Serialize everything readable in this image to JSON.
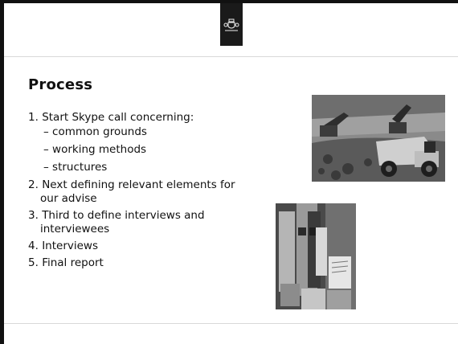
{
  "slide": {
    "title": "Process",
    "items": [
      {
        "num": "1.",
        "text": "Start Skype call concerning:",
        "sub": [
          "common grounds",
          "working methods",
          "structures"
        ]
      },
      {
        "num": "2.",
        "text": "Next defining relevant elements for our advise"
      },
      {
        "num": "3.",
        "text": "Third to define interviews and interviewees"
      },
      {
        "num": "4.",
        "text": "Interviews"
      },
      {
        "num": "5.",
        "text": "Final report"
      }
    ],
    "bullet_char": "–"
  },
  "images": {
    "top_photo": "construction-site-excavator-dump-truck",
    "bottom_photo": "coffee-cups-display"
  },
  "colors": {
    "frame": "#111111",
    "rule": "#d9d9d9"
  }
}
